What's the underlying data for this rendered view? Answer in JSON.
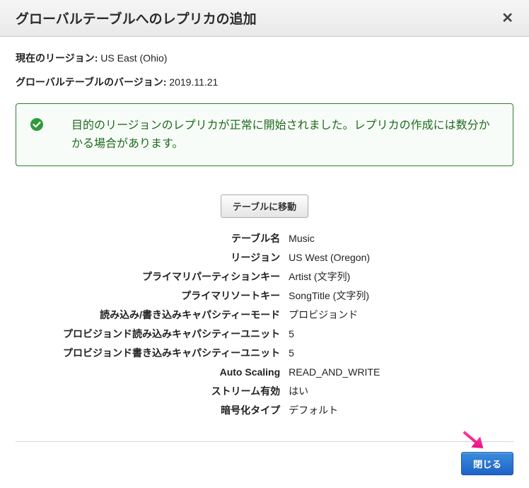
{
  "header": {
    "title": "グローバルテーブルへのレプリカの追加"
  },
  "info": {
    "current_region_label": "現在のリージョン:",
    "current_region_value": "US East (Ohio)",
    "version_label": "グローバルテーブルのバージョン:",
    "version_value": "2019.11.21"
  },
  "alert": {
    "message": "目的のリージョンのレプリカが正常に開始されました。レプリカの作成には数分かかる場合があります。"
  },
  "actions": {
    "go_to_table": "テーブルに移動",
    "close": "閉じる"
  },
  "details": [
    {
      "label": "テーブル名",
      "value": "Music"
    },
    {
      "label": "リージョン",
      "value": "US West (Oregon)"
    },
    {
      "label": "プライマリパーティションキー",
      "value": "Artist (文字列)"
    },
    {
      "label": "プライマリソートキー",
      "value": "SongTitle (文字列)"
    },
    {
      "label": "読み込み/書き込みキャパシティーモード",
      "value": "プロビジョンド"
    },
    {
      "label": "プロビジョンド読み込みキャパシティーユニット",
      "value": "5"
    },
    {
      "label": "プロビジョンド書き込みキャパシティーユニット",
      "value": "5"
    },
    {
      "label": "Auto Scaling",
      "value": "READ_AND_WRITE"
    },
    {
      "label": "ストリーム有効",
      "value": "はい"
    },
    {
      "label": "暗号化タイプ",
      "value": "デフォルト"
    }
  ]
}
